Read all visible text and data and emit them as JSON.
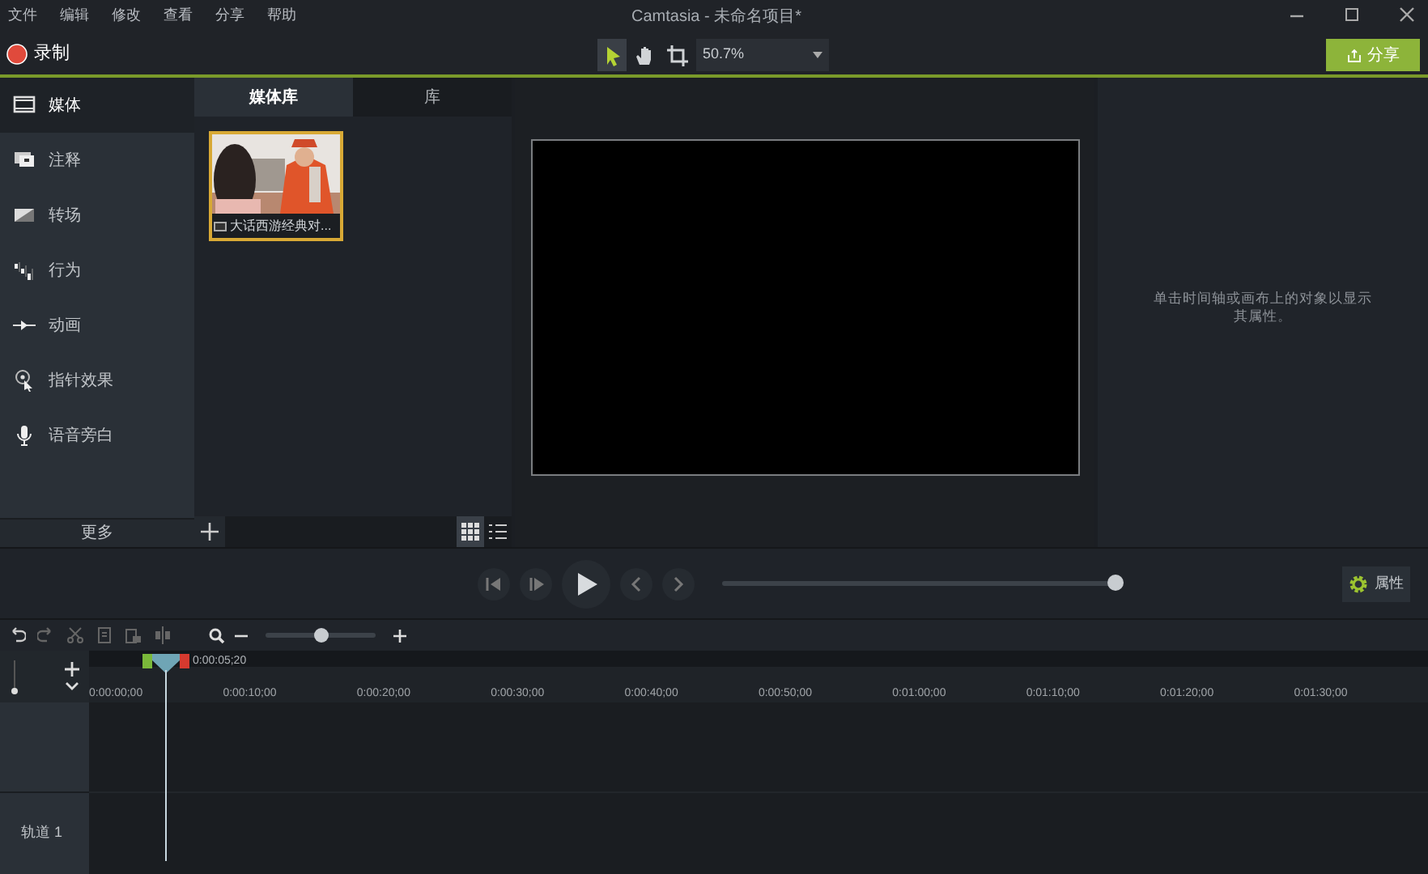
{
  "menu": [
    "文件",
    "编辑",
    "修改",
    "查看",
    "分享",
    "帮助"
  ],
  "window": {
    "title": "Camtasia - 未命名项目*"
  },
  "toolbar": {
    "record": "录制",
    "tools": [
      {
        "kind": "pointer",
        "selected": true
      },
      {
        "kind": "hand",
        "selected": false
      },
      {
        "kind": "crop",
        "selected": false
      }
    ],
    "zoom": "50.7%",
    "share": "分享"
  },
  "sidebar": {
    "items": [
      {
        "kind": "media",
        "label": "媒体",
        "selected": true
      },
      {
        "kind": "annotation",
        "label": "注释",
        "selected": false
      },
      {
        "kind": "transition",
        "label": "转场",
        "selected": false
      },
      {
        "kind": "behavior",
        "label": "行为",
        "selected": false
      },
      {
        "kind": "animation",
        "label": "动画",
        "selected": false
      },
      {
        "kind": "cursor",
        "label": "指针效果",
        "selected": false
      },
      {
        "kind": "voice",
        "label": "语音旁白",
        "selected": false
      }
    ],
    "more": "更多"
  },
  "media_panel": {
    "tabs": [
      {
        "label": "媒体库",
        "selected": true
      },
      {
        "label": "库",
        "selected": false
      }
    ],
    "items": [
      {
        "kind": "picture",
        "label": "大话西游经典对...",
        "selected": true
      }
    ],
    "views": [
      {
        "kind": "grid",
        "selected": true
      },
      {
        "kind": "list",
        "selected": false
      }
    ]
  },
  "properties": {
    "hint": "单击时间轴或画布上的对象以显示其属性。",
    "button": "属性"
  },
  "playback": {
    "level": 1.0
  },
  "timeline": {
    "zoom": {
      "level": 0.5
    },
    "playhead_time": "0:00:05;20",
    "ticks": [
      "0:00:00;00",
      "0:00:10;00",
      "0:00:20;00",
      "0:00:30;00",
      "0:00:40;00",
      "0:00:50;00",
      "0:01:00;00",
      "0:01:10;00",
      "0:01:20;00",
      "0:01:30;00"
    ],
    "tracks": [
      {
        "label": "轨道 1"
      }
    ]
  }
}
